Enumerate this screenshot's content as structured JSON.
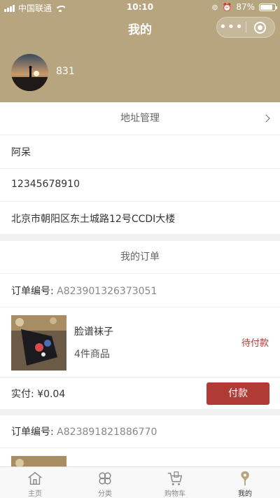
{
  "status_bar": {
    "carrier": "中国联通",
    "time": "10:10",
    "battery": "87%",
    "battery_level": 0.87
  },
  "nav": {
    "title": "我的"
  },
  "user": {
    "name": "831"
  },
  "address": {
    "title": "地址管理",
    "name": "阿呆",
    "phone": "12345678910",
    "address": "北京市朝阳区东土城路12号CCDI大楼"
  },
  "orders": {
    "title": "我的订单",
    "order_no_label": "订单编号:",
    "items": [
      {
        "order_no": "A823901326373051",
        "product": "脸谱袜子",
        "count": "4件商品",
        "status": "待付款",
        "paid_label": "实付:",
        "paid": "¥0.04",
        "pay_button": "付款"
      },
      {
        "order_no": "A823891821886770"
      }
    ]
  },
  "tabbar": {
    "items": [
      {
        "label": "主页",
        "icon": "home-icon"
      },
      {
        "label": "分类",
        "icon": "category-icon"
      },
      {
        "label": "购物车",
        "icon": "cart-icon"
      },
      {
        "label": "我的",
        "icon": "profile-icon"
      }
    ]
  },
  "colors": {
    "header": "#b6a57e",
    "accent": "#b03a34",
    "active_tab": "#b6a57e"
  }
}
